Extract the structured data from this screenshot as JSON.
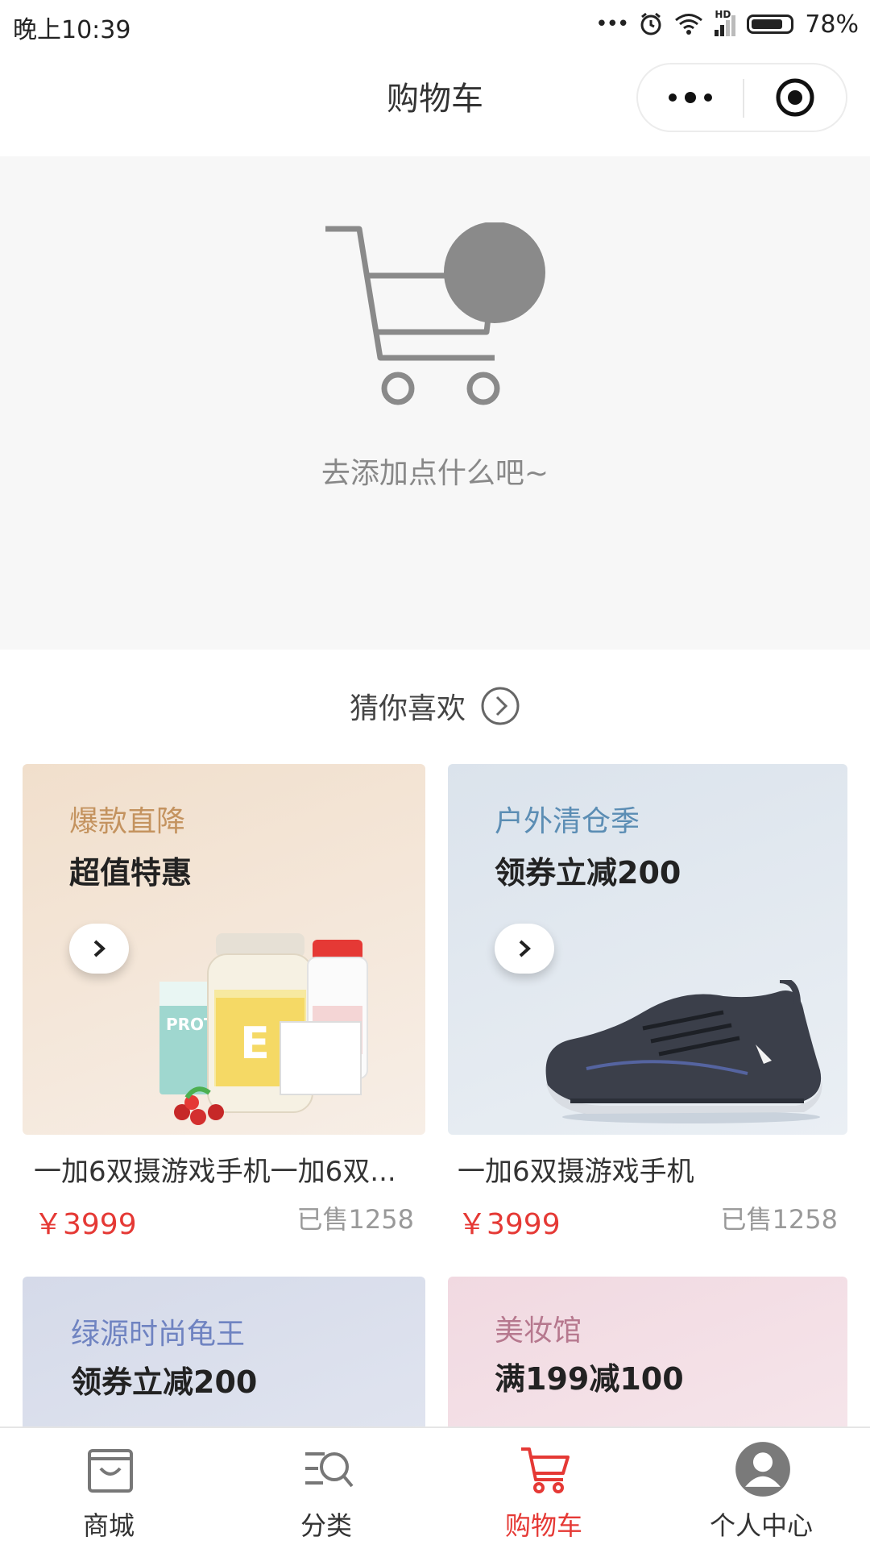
{
  "status_bar": {
    "time": "晚上10:39",
    "signal_label": "HD",
    "battery": "78%"
  },
  "header": {
    "title": "购物车"
  },
  "empty_cart": {
    "message": "去添加点什么吧~"
  },
  "recommend": {
    "title": "猜你喜欢"
  },
  "products": [
    {
      "tag": "爆款直降",
      "subtitle": "超值特惠",
      "name": "一加6双摄游戏手机一加6双...",
      "price": "￥3999",
      "sold": "已售1258",
      "bg_from": "#f3e5d6",
      "bg_to": "#f6ece3",
      "tag_color": "#c79a6b"
    },
    {
      "tag": "户外清仓季",
      "subtitle": "领券立减200",
      "name": "一加6双摄游戏手机",
      "price": "￥3999",
      "sold": "已售1258",
      "bg_from": "#dfe6ee",
      "bg_to": "#e9eef3",
      "tag_color": "#5b8db4"
    },
    {
      "tag": "绿源时尚龟王",
      "subtitle": "领券立减200",
      "bg_from": "#d7dcea",
      "bg_to": "#e2e6f1",
      "tag_color": "#6f83c1"
    },
    {
      "tag": "美妆馆",
      "subtitle": "满199减100",
      "bg_from": "#f2dbe2",
      "bg_to": "#f6e6eb",
      "tag_color": "#b6788e"
    }
  ],
  "tabs": [
    {
      "label": "商城",
      "icon": "shop-bag-icon",
      "active": false
    },
    {
      "label": "分类",
      "icon": "category-search-icon",
      "active": false
    },
    {
      "label": "购物车",
      "icon": "cart-icon",
      "active": true
    },
    {
      "label": "个人中心",
      "icon": "user-icon",
      "active": false
    }
  ],
  "colors": {
    "accent": "#e53935",
    "empty_bg": "#f7f7f7"
  }
}
